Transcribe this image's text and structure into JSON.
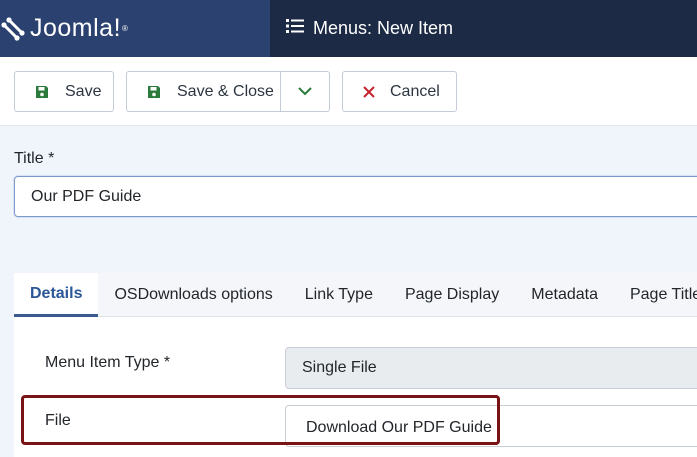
{
  "header": {
    "brand": "Joomla!",
    "brand_reg": "®",
    "page_title": "Menus: New Item",
    "icons": {
      "brand": "joomla-logo-icon",
      "title": "list-icon"
    },
    "colors": {
      "brand_bg": "#2b4270",
      "header_bg": "#1c2a45"
    }
  },
  "toolbar": {
    "save_label": "Save",
    "save_close_label": "Save & Close",
    "cancel_label": "Cancel",
    "icons": {
      "save": "floppy-disk-icon",
      "dropdown": "chevron-down-icon",
      "cancel": "close-icon"
    },
    "colors": {
      "save_icon": "#2a7a3b",
      "cancel_icon": "#c4232d"
    }
  },
  "title_field": {
    "label": "Title *",
    "value": "Our PDF Guide"
  },
  "tabs": [
    {
      "label": "Details",
      "active": true
    },
    {
      "label": "OSDownloads options",
      "active": false
    },
    {
      "label": "Link Type",
      "active": false
    },
    {
      "label": "Page Display",
      "active": false
    },
    {
      "label": "Metadata",
      "active": false
    },
    {
      "label": "Page Title",
      "active": false
    }
  ],
  "details": {
    "menu_item_type_label": "Menu Item Type *",
    "menu_item_type_value": "Single File",
    "file_label": "File",
    "file_value": "Download Our PDF Guide",
    "highlight_color": "#7a1414"
  }
}
